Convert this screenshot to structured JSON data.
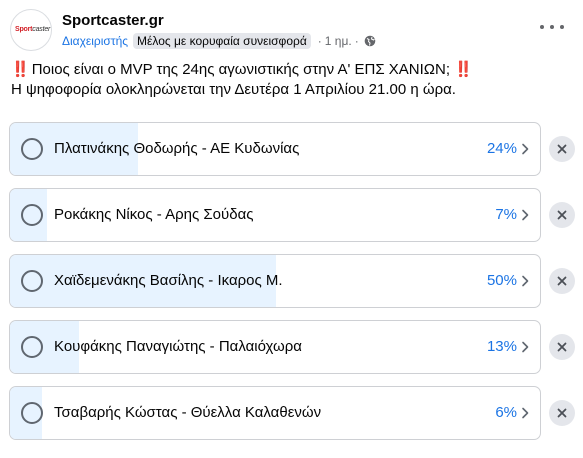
{
  "header": {
    "avatar_logo_red": "Sport",
    "avatar_logo_rest": "caster",
    "page_name": "Sportcaster.gr",
    "role": "Διαχειριστής",
    "badge": "Μέλος με κορυφαία συνεισφορά",
    "separator": "·",
    "time": "1 ημ.",
    "separator2": "·"
  },
  "post": {
    "question_prefix": "‼️",
    "question": "Ποιος είναι ο MVP της 24ης αγωνιστικής στην Α' ΕΠΣ ΧΑΝΙΩΝ;",
    "question_suffix": "‼️",
    "subtitle": "Η ψηφοφορία ολοκληρώνεται την Δευτέρα 1 Απριλίου 21.00 η ώρα."
  },
  "poll": {
    "options": [
      {
        "label": "Πλατινάκης Θοδωρής - ΑΕ Κυδωνίας",
        "percent": "24%",
        "value": 24
      },
      {
        "label": "Ροκάκης Νίκος - Αρης Σούδας",
        "percent": "7%",
        "value": 7
      },
      {
        "label": "Χαϊδεμενάκης Βασίλης - Ικαρος Μ.",
        "percent": "50%",
        "value": 50
      },
      {
        "label": "Κουφάκης Παναγιώτης - Παλαιόχωρα",
        "percent": "13%",
        "value": 13
      },
      {
        "label": "Τσαβαρής Κώστας - Θύελλα Καλαθενών",
        "percent": "6%",
        "value": 6
      }
    ]
  },
  "colors": {
    "accent": "#1b74e4",
    "fill": "#e7f3ff",
    "alert": "#e41e3f"
  },
  "icons": {
    "globe": "globe-icon",
    "more": "more-options-icon",
    "chevron": "chevron-right-icon",
    "remove": "close-icon"
  }
}
